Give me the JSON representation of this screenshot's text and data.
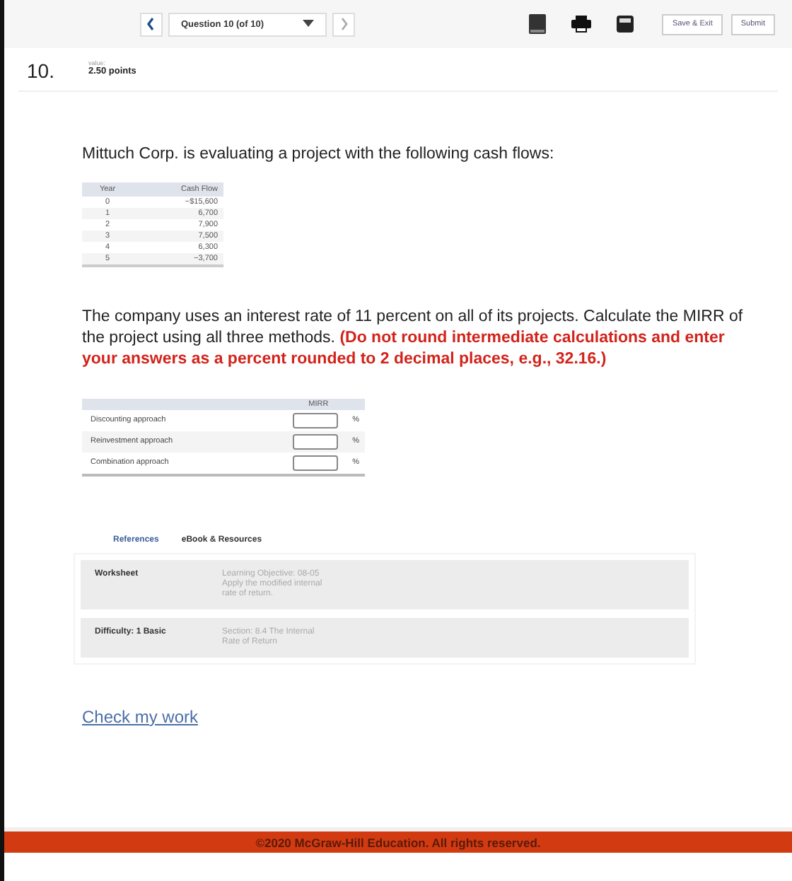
{
  "toolbar": {
    "question_select": "Question 10 (of 10)",
    "buttons": [
      "Save & Exit",
      "Submit"
    ]
  },
  "question": {
    "number": "10.",
    "value_label": "value:",
    "points": "2.50 points"
  },
  "intro": "Mittuch Corp. is evaluating a project with the following cash flows:",
  "cash_table": {
    "columns": [
      "Year",
      "Cash Flow"
    ],
    "rows": [
      [
        "0",
        "−$15,600"
      ],
      [
        "1",
        "6,700"
      ],
      [
        "2",
        "7,900"
      ],
      [
        "3",
        "7,500"
      ],
      [
        "4",
        "6,300"
      ],
      [
        "5",
        "−3,700"
      ]
    ]
  },
  "prompt": "The company uses an interest rate of 11 percent on all of its projects. Calculate the MIRR of the project using all three methods. **(Do not round intermediate calculations and enter your answers as a percent rounded to 2 decimal places, e.g., 32.16.)**",
  "answer_table": {
    "column": "MIRR",
    "rows": [
      {
        "label": "Discounting approach",
        "unit": "%"
      },
      {
        "label": "Reinvestment approach",
        "unit": "%"
      },
      {
        "label": "Combination approach",
        "unit": "%"
      }
    ]
  },
  "tabs": [
    {
      "label": "References",
      "selected": true
    },
    {
      "label": "eBook & Resources",
      "selected": false
    }
  ],
  "references": [
    {
      "title": "Worksheet",
      "lines": [
        "Learning Objective: 08-05",
        "Apply the modified internal",
        "rate of return."
      ]
    },
    {
      "title": "Difficulty: 1 Basic",
      "lines": [
        "Section: 8.4 The Internal",
        "Rate of Return"
      ]
    }
  ],
  "check_link": "Check my work",
  "footer": "©2020 McGraw-Hill Education. All rights reserved."
}
